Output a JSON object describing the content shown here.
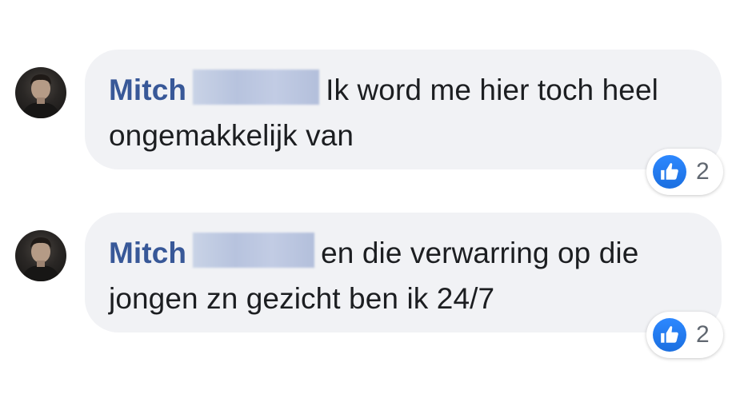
{
  "comments": [
    {
      "author": "Mitch",
      "text_before": "",
      "text_after": "Ik word me hier toch heel ongemakkelijk van",
      "reaction": {
        "icon": "thumbs-up-icon",
        "count": "2"
      }
    },
    {
      "author": "Mitch",
      "text_after": "en die verwarring op die jongen zn gezicht ben ik 24/7",
      "reaction": {
        "icon": "thumbs-up-icon",
        "count": "2"
      }
    }
  ],
  "colors": {
    "author": "#385898",
    "bubble": "#f1f2f5",
    "like": "#1b74e4"
  }
}
